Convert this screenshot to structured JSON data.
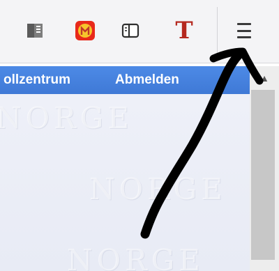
{
  "toolbar": {
    "icons": [
      "reader-view-icon",
      "firefox-app-icon",
      "sidebar-icon",
      "text-T-icon",
      "hamburger-menu-icon"
    ],
    "t_letter": "T"
  },
  "navbar": {
    "left_link": "ollzentrum",
    "logout_link": "Abmelden"
  },
  "watermark": {
    "rows": [
      "NORGE",
      "NORGE",
      "NORGE"
    ]
  },
  "colors": {
    "navbar": "#4586e0",
    "annotation_arrow": "#000000",
    "t_icon": "#b5281f",
    "app_icon": "#e8291a"
  }
}
